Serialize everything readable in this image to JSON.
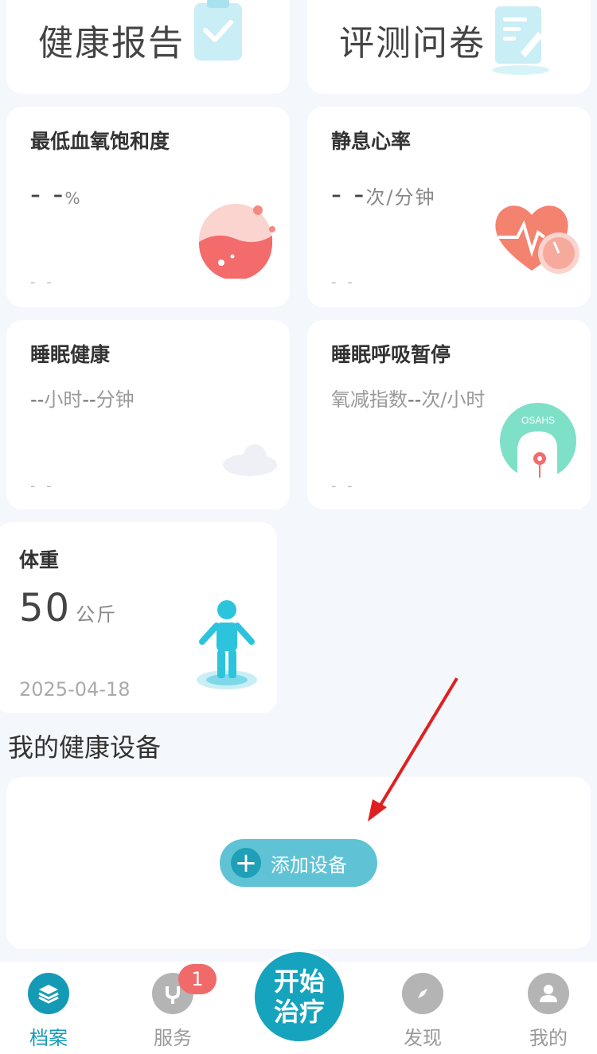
{
  "top_cards": {
    "health_report": "健康报告",
    "questionnaire": "评测问卷"
  },
  "metrics": {
    "spo2": {
      "title": "最低血氧饱和度",
      "value": "- -",
      "unit": "%",
      "date": "- -"
    },
    "heart_rate": {
      "title": "静息心率",
      "value": "- -",
      "unit": "次/分钟",
      "date": "- -"
    },
    "sleep": {
      "title": "睡眠健康",
      "placeholder_a": "--",
      "unit_a": "小时",
      "placeholder_b": "--",
      "unit_b": "分钟",
      "date": "- -"
    },
    "apnea": {
      "title": "睡眠呼吸暂停",
      "label": "氧减指数",
      "placeholder": "--",
      "unit": "次/小时",
      "badge": "OSAHS",
      "date": "- -"
    },
    "weight": {
      "title": "体重",
      "value": "50",
      "unit": "公斤",
      "date": "2025-04-18"
    }
  },
  "devices": {
    "section_title": "我的健康设备",
    "add_button": "添加设备"
  },
  "tabbar": {
    "items": [
      "档案",
      "服务",
      "发现",
      "我的"
    ],
    "service_badge": "1",
    "center_line1": "开始",
    "center_line2": "治疗",
    "active": "档案"
  },
  "colors": {
    "accent": "#159ab6",
    "badge": "#f16a6a",
    "annotation": "#e02020"
  }
}
